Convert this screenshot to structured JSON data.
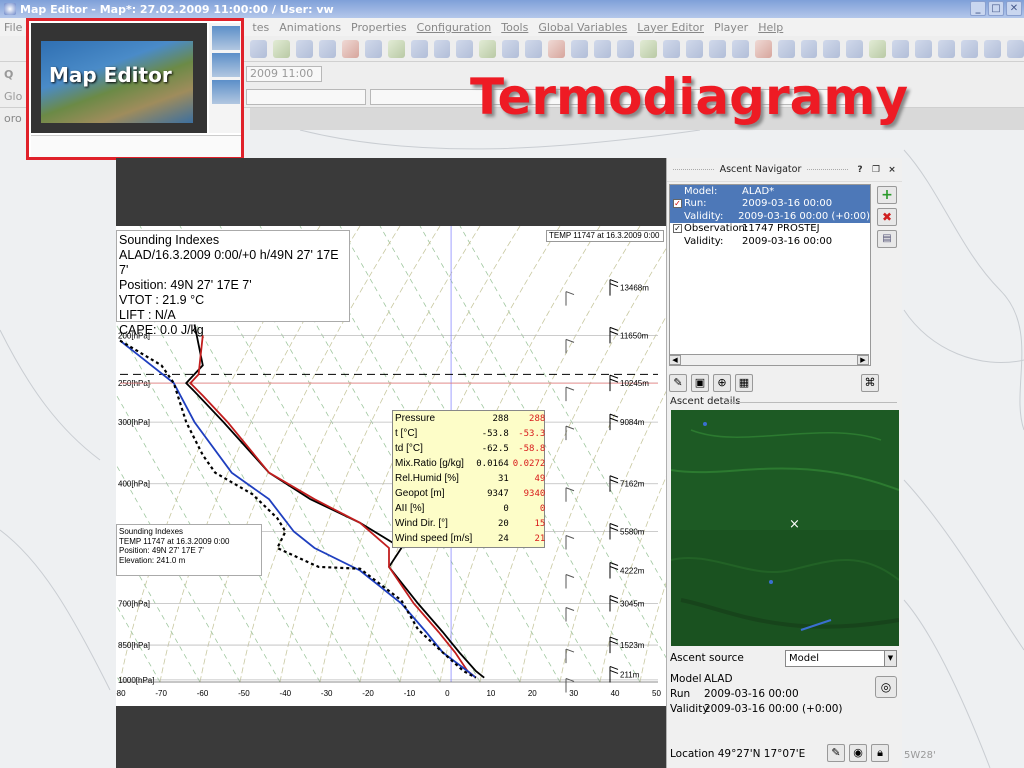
{
  "window": {
    "title": "Map Editor - Map*: 27.02.2009 11:00:00 / User: vw",
    "minimize": "_",
    "maximize": "□",
    "close": "✕"
  },
  "menubar": {
    "visible_left": "File",
    "items": [
      "tes",
      "Animations",
      "Properties",
      "Configuration",
      "Tools",
      "Global Variables",
      "Layer Editor",
      "Player",
      "Help"
    ]
  },
  "toolbar2": {
    "left_icon": "Q",
    "time_value": "2009 11:00"
  },
  "toolbar3": {
    "left_text": "Glo"
  },
  "toolbar4": {
    "left_text": "oro"
  },
  "thumbnail": {
    "label": "Map Editor"
  },
  "slide_title": "Termodiagramy",
  "sounding_indexes": {
    "lines": [
      "Sounding Indexes",
      "ALAD/16.3.2009 0:00/+0 h/49N 27' 17E 7'",
      "Position: 49N 27' 17E 7'",
      "VTOT : 21.9 °C",
      "LIFT : N/A",
      "CAPE: 0.0 J/kg"
    ]
  },
  "sounding_indexes_obs": {
    "lines": [
      "Sounding Indexes",
      "TEMP 11747 at 16.3.2009 0:00",
      "Position: 49N 27' 17E 7'",
      "Elevation: 241.0 m"
    ]
  },
  "temp_label": "TEMP 11747 at 16.3.2009 0:00",
  "tooltip": {
    "rows": [
      {
        "label": "Pressure",
        "v1": "288",
        "v2": "288"
      },
      {
        "label": "t [°C]",
        "v1": "-53.8",
        "v2": "-53.3"
      },
      {
        "label": "td [°C]",
        "v1": "-62.5",
        "v2": "-58.8"
      },
      {
        "label": "Mix.Ratio [g/kg]",
        "v1": "0.0164",
        "v2": "0.0272"
      },
      {
        "label": "Rel.Humid [%]",
        "v1": "31",
        "v2": "49"
      },
      {
        "label": "Geopot [m]",
        "v1": "9347",
        "v2": "9340"
      },
      {
        "label": "AII [%]",
        "v1": "0",
        "v2": "0"
      },
      {
        "label": "Wind Dir. [°]",
        "v1": "20",
        "v2": "15"
      },
      {
        "label": "Wind speed [m/s]",
        "v1": "24",
        "v2": "21"
      }
    ]
  },
  "chart_data": {
    "type": "line",
    "x_axis": {
      "ticks": [
        -80,
        -70,
        -60,
        -50,
        -40,
        -30,
        -20,
        -10,
        0,
        10,
        20,
        30,
        40,
        50
      ],
      "range": [
        -80,
        50
      ]
    },
    "pressure_levels": [
      {
        "label": "200[hPa]",
        "p": 200
      },
      {
        "label": "250[hPa]",
        "p": 250
      },
      {
        "label": "300[hPa]",
        "p": 300
      },
      {
        "label": "400[hPa]",
        "p": 400
      },
      {
        "label": "500[hPa]",
        "p": 500
      },
      {
        "label": "700[hPa]",
        "p": 700
      },
      {
        "label": "850[hPa]",
        "p": 850
      },
      {
        "label": "1000[hPa]",
        "p": 1000
      }
    ],
    "height_labels": [
      {
        "label": "13468m",
        "p": 160
      },
      {
        "label": "11650m",
        "p": 200
      },
      {
        "label": "10245m",
        "p": 250
      },
      {
        "label": "9084m",
        "p": 300
      },
      {
        "label": "7162m",
        "p": 400
      },
      {
        "label": "5580m",
        "p": 500
      },
      {
        "label": "4222m",
        "p": 600
      },
      {
        "label": "3045m",
        "p": 700
      },
      {
        "label": "1523m",
        "p": 850
      },
      {
        "label": "211m",
        "p": 975
      }
    ],
    "cursor_pressure": 240,
    "series": [
      {
        "color": "#000000",
        "style": "solid",
        "points": [
          [
            -62,
            190
          ],
          [
            -60,
            230
          ],
          [
            -64,
            250
          ],
          [
            -62,
            260
          ],
          [
            -55,
            300
          ],
          [
            -44,
            380
          ],
          [
            -34,
            430
          ],
          [
            -22,
            480
          ],
          [
            -12,
            540
          ],
          [
            -15,
            590
          ],
          [
            -8,
            700
          ],
          [
            -2,
            800
          ],
          [
            2,
            880
          ],
          [
            6,
            960
          ],
          [
            8,
            990
          ]
        ]
      },
      {
        "color": "#c21e1e",
        "style": "solid",
        "points": [
          [
            -60,
            200
          ],
          [
            -61,
            240
          ],
          [
            -63,
            250
          ],
          [
            -60,
            265
          ],
          [
            -54,
            300
          ],
          [
            -44,
            380
          ],
          [
            -33,
            430
          ],
          [
            -22,
            480
          ],
          [
            -15,
            540
          ],
          [
            -15,
            590
          ],
          [
            -9,
            700
          ],
          [
            -3,
            800
          ],
          [
            1,
            880
          ],
          [
            4,
            960
          ],
          [
            6,
            990
          ]
        ]
      },
      {
        "color": "#1f3fbf",
        "style": "solid",
        "points": [
          [
            -80,
            205
          ],
          [
            -67,
            250
          ],
          [
            -62,
            300
          ],
          [
            -53,
            380
          ],
          [
            -44,
            430
          ],
          [
            -38,
            500
          ],
          [
            -33,
            540
          ],
          [
            -22,
            600
          ],
          [
            -12,
            700
          ],
          [
            -6,
            800
          ],
          [
            -2,
            880
          ],
          [
            4,
            960
          ],
          [
            6,
            990
          ]
        ]
      },
      {
        "color": "#000000",
        "style": "dotted",
        "points": [
          [
            -80,
            205
          ],
          [
            -70,
            230
          ],
          [
            -67,
            250
          ],
          [
            -64,
            300
          ],
          [
            -60,
            350
          ],
          [
            -57,
            380
          ],
          [
            -48,
            420
          ],
          [
            -42,
            470
          ],
          [
            -40,
            500
          ],
          [
            -42,
            540
          ],
          [
            -32,
            590
          ],
          [
            -22,
            595
          ],
          [
            -12,
            690
          ],
          [
            -8,
            790
          ],
          [
            -2,
            880
          ],
          [
            3,
            960
          ],
          [
            6,
            990
          ]
        ]
      }
    ]
  },
  "navigator": {
    "title": "Ascent Navigator",
    "help": "?",
    "float": "❐",
    "close": "×",
    "rows": [
      {
        "key": "Model:",
        "val": "ALAD*",
        "sel": true,
        "cb": ""
      },
      {
        "key": "Run:",
        "val": "2009-03-16 00:00",
        "sel": true,
        "cb": "red"
      },
      {
        "key": "Validity:",
        "val": "2009-03-16 00:00 (+0:00)",
        "sel": true,
        "cb": ""
      },
      {
        "key": "Observation:",
        "val": "11747 PROSTEJ",
        "sel": false,
        "cb": "black"
      },
      {
        "key": "Validity:",
        "val": "2009-03-16 00:00",
        "sel": false,
        "cb": ""
      }
    ],
    "add": "+",
    "remove": "✖",
    "details_label": "Ascent details",
    "source_label": "Ascent source",
    "source_value": "Model",
    "info": [
      {
        "k": "Model",
        "v": "ALAD"
      },
      {
        "k": "Run",
        "v": "2009-03-16 00:00"
      },
      {
        "k": "Validity",
        "v": "2009-03-16 00:00 (+0:00)"
      }
    ],
    "location": "Location 49°27'N 17°07'E"
  },
  "status_right": "5W28'",
  "colors": {
    "accent_red": "#ee1b24",
    "selection_blue": "#4d78b8",
    "minimap_green": "#1d5a24"
  }
}
